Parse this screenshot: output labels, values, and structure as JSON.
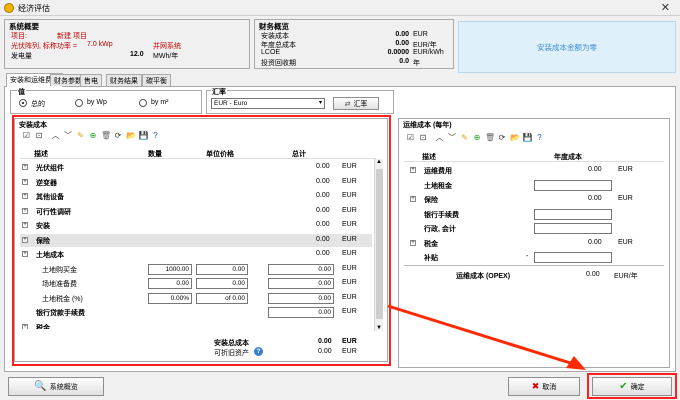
{
  "window": {
    "title": "经济评估",
    "close": "✕"
  },
  "system_overview": {
    "title": "系统概要",
    "project_label": "项目:",
    "project_value": "新建 项目",
    "pv_label": "光伏阵列, 标称功率 =",
    "pv_value": "7.0 kWp",
    "pv_type": "并网系统",
    "gen_label": "发电量",
    "gen_value": "12.0",
    "gen_unit": "MWh/年"
  },
  "financial_overview": {
    "title": "财务概览",
    "rows": [
      {
        "label": "安装成本",
        "value": "0.00",
        "unit": "EUR"
      },
      {
        "label": "年度总成本",
        "value": "0.00",
        "unit": "EUR/年"
      },
      {
        "label": "LCOE",
        "value": "0.0000",
        "unit": "EUR/kWh"
      },
      {
        "label": "投资回收期",
        "value": "0.0",
        "unit": "年"
      }
    ]
  },
  "warning_text": "安装成本金额为零",
  "tabs": [
    "安装和运维费用",
    "财务参数",
    "售电",
    "财务结果",
    "碳平衡"
  ],
  "value_group": {
    "title": "值",
    "options": [
      "总的",
      "by Wp",
      "by m²"
    ],
    "selected": 0
  },
  "currency_group": {
    "title": "汇率",
    "selected": "EUR - Euro",
    "button_label": "汇率"
  },
  "install_cost": {
    "title": "安装成本",
    "headers": {
      "desc": "描述",
      "qty": "数量",
      "unit_price": "单位价格",
      "total": "总计"
    },
    "rows": [
      {
        "label": "光伏组件",
        "total": "0.00",
        "cur": "EUR"
      },
      {
        "label": "逆变器",
        "total": "0.00",
        "cur": "EUR"
      },
      {
        "label": "其他设备",
        "total": "0.00",
        "cur": "EUR"
      },
      {
        "label": "可行性调研",
        "total": "0.00",
        "cur": "EUR"
      },
      {
        "label": "安装",
        "total": "0.00",
        "cur": "EUR"
      },
      {
        "label": "保险",
        "total": "0.00",
        "cur": "EUR"
      },
      {
        "label": "土地成本",
        "total": "0.00",
        "cur": "EUR"
      }
    ],
    "sub_rows": [
      {
        "label": "土地购买金",
        "qty": "1000.00",
        "price": "0.00",
        "total": "0.00",
        "cur": "EUR"
      },
      {
        "label": "场地准备费",
        "qty": "0.00",
        "price": "0.00",
        "total": "0.00",
        "cur": "EUR"
      },
      {
        "label": "土地税金 (%)",
        "qty": "0.00%",
        "price": "of 0.00",
        "total": "0.00",
        "cur": "EUR"
      }
    ],
    "loan_row": {
      "label": "银行贷款手续费",
      "total": "0.00",
      "cur": "EUR"
    },
    "tax_row": {
      "label": "税金"
    },
    "total_label": "安装总成本",
    "total_value": "0.00",
    "total_cur": "EUR",
    "depreciable_label": "可折旧资产",
    "depreciable_value": "0.00",
    "depreciable_cur": "EUR"
  },
  "om_cost": {
    "title": "运维成本 (每年)",
    "headers": {
      "desc": "描述",
      "annual": "年度成本"
    },
    "rows": [
      {
        "label": "运维费用",
        "value": "0.00",
        "cur": "EUR",
        "input": false,
        "expand": true
      },
      {
        "label": "土地租金",
        "value": "",
        "cur": "",
        "input": true,
        "expand": false
      },
      {
        "label": "保险",
        "value": "0.00",
        "cur": "EUR",
        "input": false,
        "expand": true
      },
      {
        "label": "银行手续费",
        "value": "",
        "cur": "",
        "input": true,
        "expand": false
      },
      {
        "label": "行政, 会计",
        "value": "",
        "cur": "",
        "input": true,
        "expand": false
      },
      {
        "label": "税金",
        "value": "0.00",
        "cur": "EUR",
        "input": false,
        "expand": true
      },
      {
        "label": "补贴",
        "value": "",
        "cur": "",
        "input": true,
        "expand": false,
        "prefix": "-"
      }
    ],
    "total_label": "运维成本 (OPEX)",
    "total_value": "0.00",
    "total_unit": "EUR/年"
  },
  "buttons": {
    "overview": "系统概览",
    "cancel": "取消",
    "ok": "确定"
  },
  "colors": {
    "highlight": "#ff2020",
    "warning_bg": "#dff0fb",
    "warning_text": "#3c8fd8"
  }
}
